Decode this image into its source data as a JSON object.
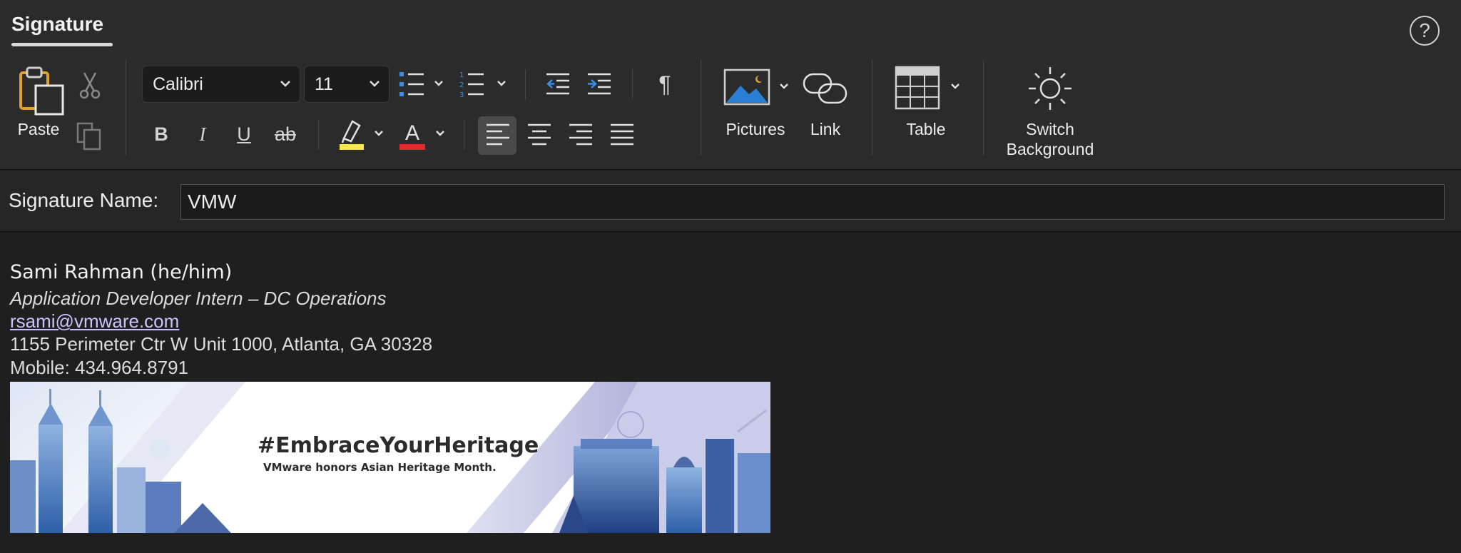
{
  "ribbon": {
    "tab": "Signature",
    "help_glyph": "?",
    "paste_label": "Paste",
    "font_name": "Calibri",
    "font_size": "11",
    "bold": "B",
    "italic": "I",
    "underline": "U",
    "strike": "ab",
    "font_color_glyph": "A",
    "pilcrow": "¶",
    "pictures_label": "Pictures",
    "link_label": "Link",
    "table_label": "Table",
    "switch_label_1": "Switch",
    "switch_label_2": "Background",
    "colors": {
      "highlight": "#f7e94a",
      "font_color": "#e02b2b",
      "accent": "#2a7fd4"
    }
  },
  "namebar": {
    "label": "Signature Name:",
    "value": "VMW"
  },
  "signature": {
    "name": "Sami Rahman (he/him)",
    "title": "Application Developer Intern – DC Operations",
    "email": "rsami@vmware.com",
    "address": "1155 Perimeter Ctr W Unit 1000, Atlanta, GA 30328",
    "mobile": "Mobile: 434.964.8791"
  },
  "banner": {
    "headline": "#EmbraceYourHeritage",
    "subline": "VMware honors Asian Heritage Month."
  }
}
